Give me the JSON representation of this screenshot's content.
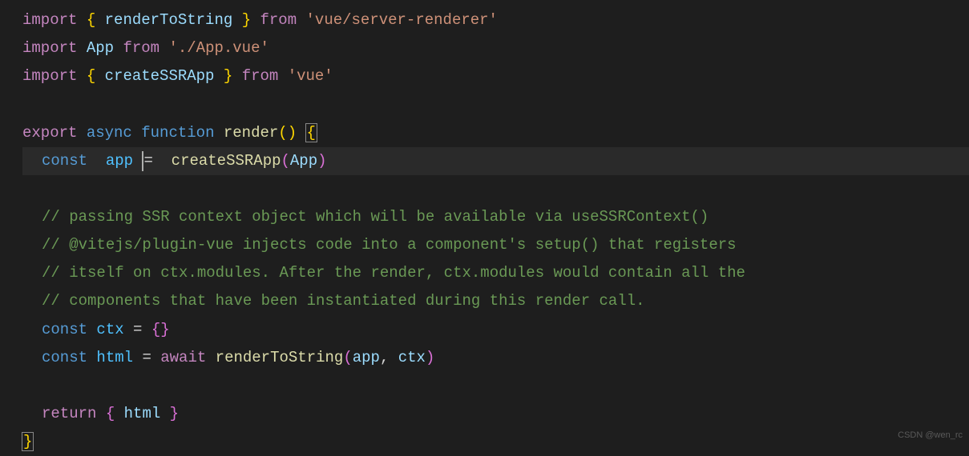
{
  "code": {
    "line1": {
      "import": "import",
      "brace_open": "{",
      "name": "renderToString",
      "brace_close": "}",
      "from": "from",
      "module": "'vue/server-renderer'"
    },
    "line2": {
      "import": "import",
      "name": "App",
      "from": "from",
      "module": "'./App.vue'"
    },
    "line3": {
      "import": "import",
      "brace_open": "{",
      "name": "createSSRApp",
      "brace_close": "}",
      "from": "from",
      "module": "'vue'"
    },
    "line5": {
      "export": "export",
      "async": "async",
      "function": "function",
      "name": "render",
      "parens": "()",
      "brace": "{"
    },
    "line6": {
      "const": "const",
      "var": "app",
      "equals": "=",
      "fn": "createSSRApp",
      "arg": "App"
    },
    "line8": {
      "comment": "// passing SSR context object which will be available via useSSRContext()"
    },
    "line9": {
      "comment": "// @vitejs/plugin-vue injects code into a component's setup() that registers"
    },
    "line10": {
      "comment": "// itself on ctx.modules. After the render, ctx.modules would contain all the"
    },
    "line11": {
      "comment": "// components that have been instantiated during this render call."
    },
    "line12": {
      "const": "const",
      "var": "ctx",
      "equals": "=",
      "braces": "{}"
    },
    "line13": {
      "const": "const",
      "var": "html",
      "equals": "=",
      "await": "await",
      "fn": "renderToString",
      "arg1": "app",
      "arg2": "ctx"
    },
    "line15": {
      "return": "return",
      "brace_open": "{",
      "var": "html",
      "brace_close": "}"
    },
    "line16": {
      "brace": "}"
    }
  },
  "watermark": "CSDN @wen_rc"
}
